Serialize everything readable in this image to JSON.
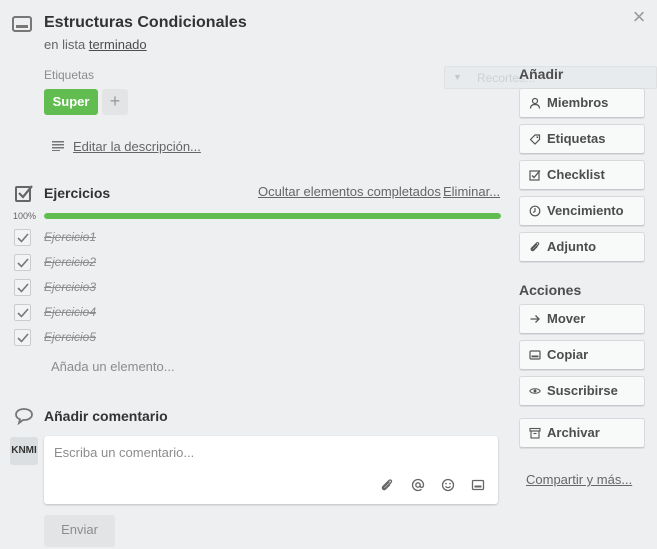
{
  "card": {
    "title": "Estructuras Condicionales",
    "in_list_prefix": "en lista",
    "list_name": "terminado"
  },
  "labels": {
    "heading": "Etiquetas",
    "items": [
      {
        "name": "Super",
        "color": "#61bd4f"
      }
    ],
    "add_symbol": "+"
  },
  "description": {
    "edit_link": "Editar la descripción..."
  },
  "ghost_overlay": {
    "text": "Recortes..."
  },
  "checklist": {
    "title": "Ejercicios",
    "hide_completed": "Ocultar elementos completados",
    "delete": "Eliminar...",
    "progress_label": "100%",
    "progress": 1.0,
    "items": [
      {
        "text": "Ejercicio1",
        "checked": true
      },
      {
        "text": "Ejercicio2",
        "checked": true
      },
      {
        "text": "Ejercicio3",
        "checked": true
      },
      {
        "text": "Ejercicio4",
        "checked": true
      },
      {
        "text": "Ejercicio5",
        "checked": true
      }
    ],
    "add_item": "Añada un elemento..."
  },
  "comment": {
    "title": "Añadir comentario",
    "avatar_initials": "KNMI",
    "placeholder": "Escriba un comentario...",
    "send": "Enviar"
  },
  "sidebar": {
    "add_heading": "Añadir",
    "add_buttons": [
      {
        "label": "Miembros",
        "icon": "person-icon"
      },
      {
        "label": "Etiquetas",
        "icon": "tag-icon"
      },
      {
        "label": "Checklist",
        "icon": "checkbox-icon"
      },
      {
        "label": "Vencimiento",
        "icon": "clock-icon"
      },
      {
        "label": "Adjunto",
        "icon": "paperclip-icon"
      }
    ],
    "actions_heading": "Acciones",
    "action_buttons": [
      {
        "label": "Mover",
        "icon": "arrow-right-icon"
      },
      {
        "label": "Copiar",
        "icon": "card-icon"
      },
      {
        "label": "Suscribirse",
        "icon": "eye-icon"
      },
      {
        "label": "Archivar",
        "icon": "archive-icon"
      }
    ],
    "share": "Compartir y más..."
  },
  "colors": {
    "accent_green": "#61bd4f",
    "background": "#edeff0"
  }
}
